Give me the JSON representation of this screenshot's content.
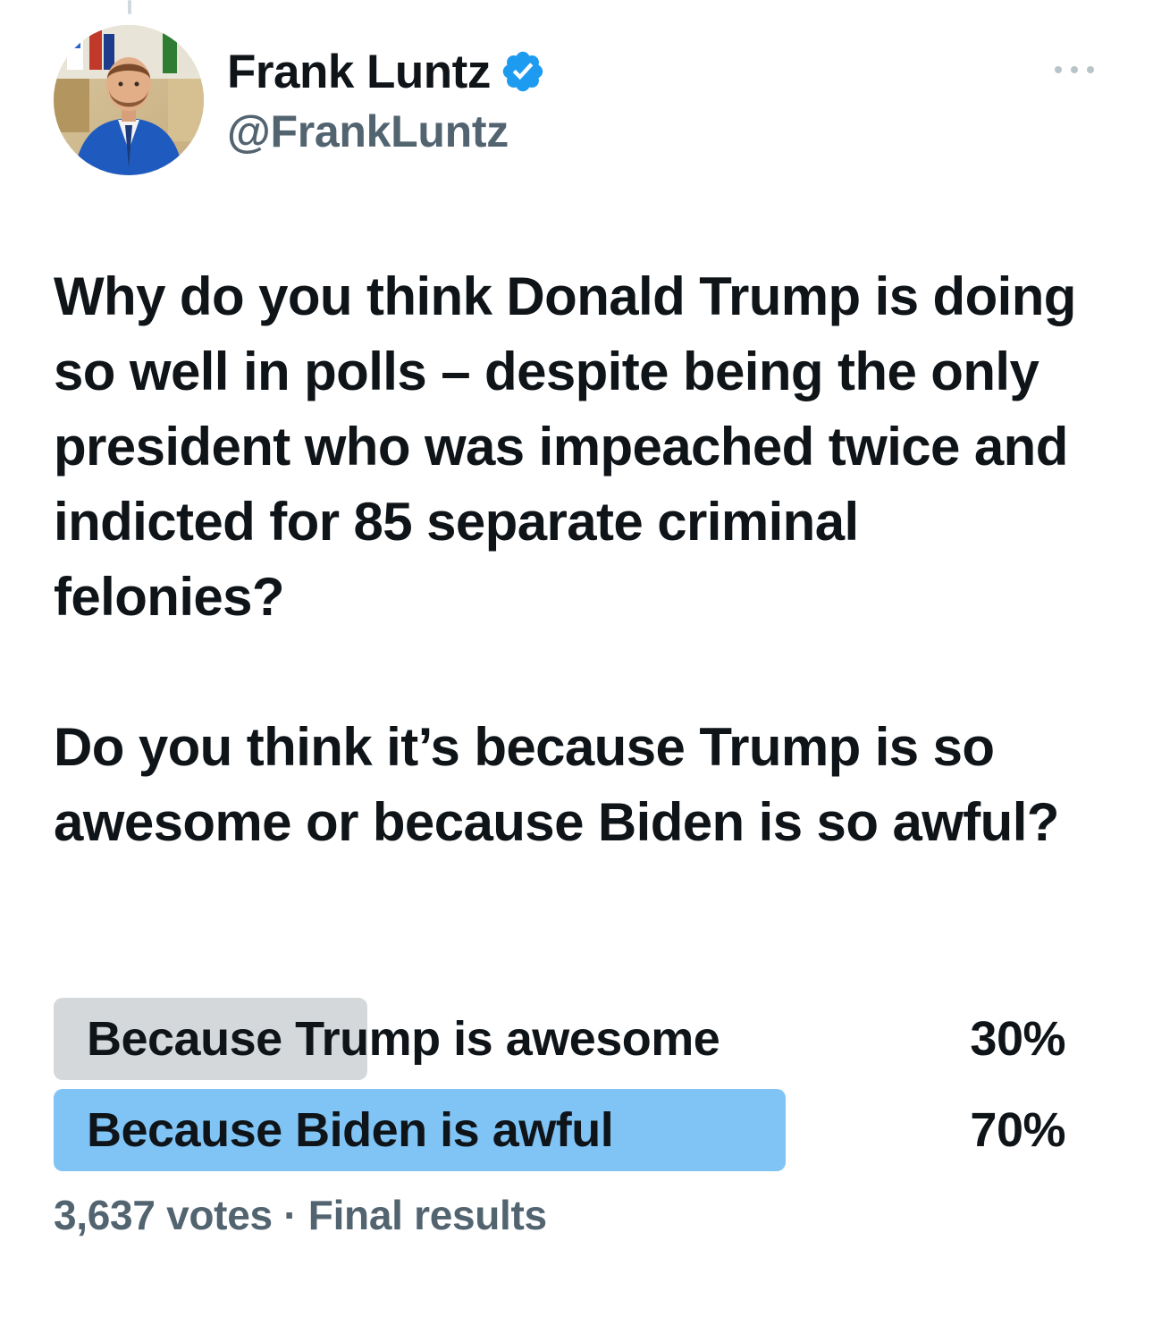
{
  "author": {
    "display_name": "Frank Luntz",
    "handle": "@FrankLuntz",
    "verified": true,
    "avatar_icon": "profile-photo"
  },
  "tweet": {
    "paragraphs": [
      "Why do you think Donald Trump is doing so well in polls – despite being the only president who was impeached twice and indicted for 85 separate criminal felonies?",
      "Do you think it’s because Trump is so awesome or because Biden is so awful?"
    ]
  },
  "poll": {
    "options": [
      {
        "label": "Because Trump is awesome",
        "percent_label": "30%",
        "share": 0.3,
        "winner": false
      },
      {
        "label": "Because Biden is awful",
        "percent_label": "70%",
        "share": 0.7,
        "winner": true
      }
    ],
    "votes": "3,637 votes",
    "separator": "·",
    "status": "Final results"
  },
  "colors": {
    "winner_bar": "#7fc4f5",
    "other_bar": "#d4d8da",
    "verified_badge": "#1d9bf0",
    "secondary_text": "#536471"
  },
  "icons": {
    "verified": "verified-badge-icon",
    "more": "more-options-icon"
  }
}
